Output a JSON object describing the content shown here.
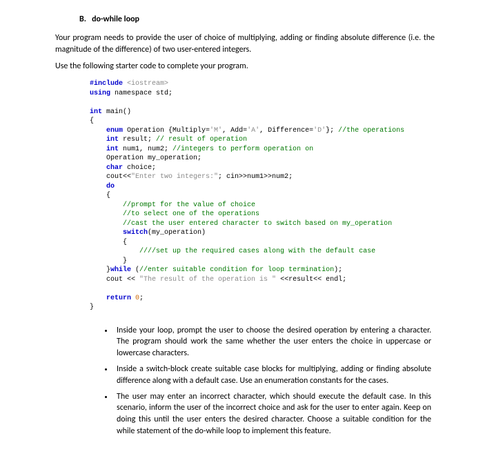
{
  "heading": "B.   do-while loop",
  "para1": "Your program needs to provide the user of choice of multiplying, adding or finding absolute difference (i.e. the magnitude of the difference) of two user-entered integers.",
  "para2": "Use the following starter code to complete your program.",
  "code": {
    "l1a": "#include",
    "l1b": " <iostream>",
    "l2a": "using",
    "l2b": " namespace ",
    "l2c": "std;",
    "l4a": "int",
    "l4b": " main()",
    "l5": "{",
    "l6a": "    enum",
    "l6b": " Operation {Multiply=",
    "l6c": "'M'",
    "l6d": ", Add=",
    "l6e": "'A'",
    "l6f": ", Difference=",
    "l6g": "'D'",
    "l6h": "}; ",
    "l6i": "//the operations",
    "l7a": "    int",
    "l7b": " result; ",
    "l7c": "// result of operation",
    "l8a": "    int",
    "l8b": " num1, num2; ",
    "l8c": "//integers to perform operation on",
    "l9": "    Operation my_operation;",
    "l10a": "    char",
    "l10b": " choice;",
    "l11a": "    cout<<",
    "l11b": "\"Enter two integers:\"",
    "l11c": "; cin>>num1>>num2;",
    "l12a": "    do",
    "l13": "    {",
    "l14": "        //prompt for the value of choice",
    "l15": "        //to select one of the operations",
    "l16": "        //cast the user entered character to switch based on my_operation",
    "l17a": "        switch",
    "l17b": "(my_operation)",
    "l18": "        {",
    "l19": "            ////set up the required cases along with the default case",
    "l20": "        }",
    "l21a": "    }",
    "l21b": "while",
    "l21c": " (",
    "l21d": "//enter suitable condition for loop termination",
    "l21e": ");",
    "l22a": "    cout << ",
    "l22b": "\"The result of the operation is \"",
    "l22c": " <<result<< endl;",
    "l24a": "    return",
    "l24b": " ",
    "l24c": "0",
    "l24d": ";",
    "l25": "}"
  },
  "bullets": [
    "Inside your loop, prompt the user to choose the desired operation by entering a character. The program should work the same whether the user enters the choice in uppercase or lowercase characters.",
    "Inside a switch-block create suitable case blocks for multiplying, adding or finding absolute difference along with a default case. Use an enumeration constants  for the cases.",
    "The user may enter an incorrect character, which should execute the default case. In this scenario, inform the user of the incorrect choice and ask for the user to enter again. Keep on doing this until the user enters the desired character. Choose a suitable condition for the while statement of the do-while loop to implement this feature."
  ]
}
